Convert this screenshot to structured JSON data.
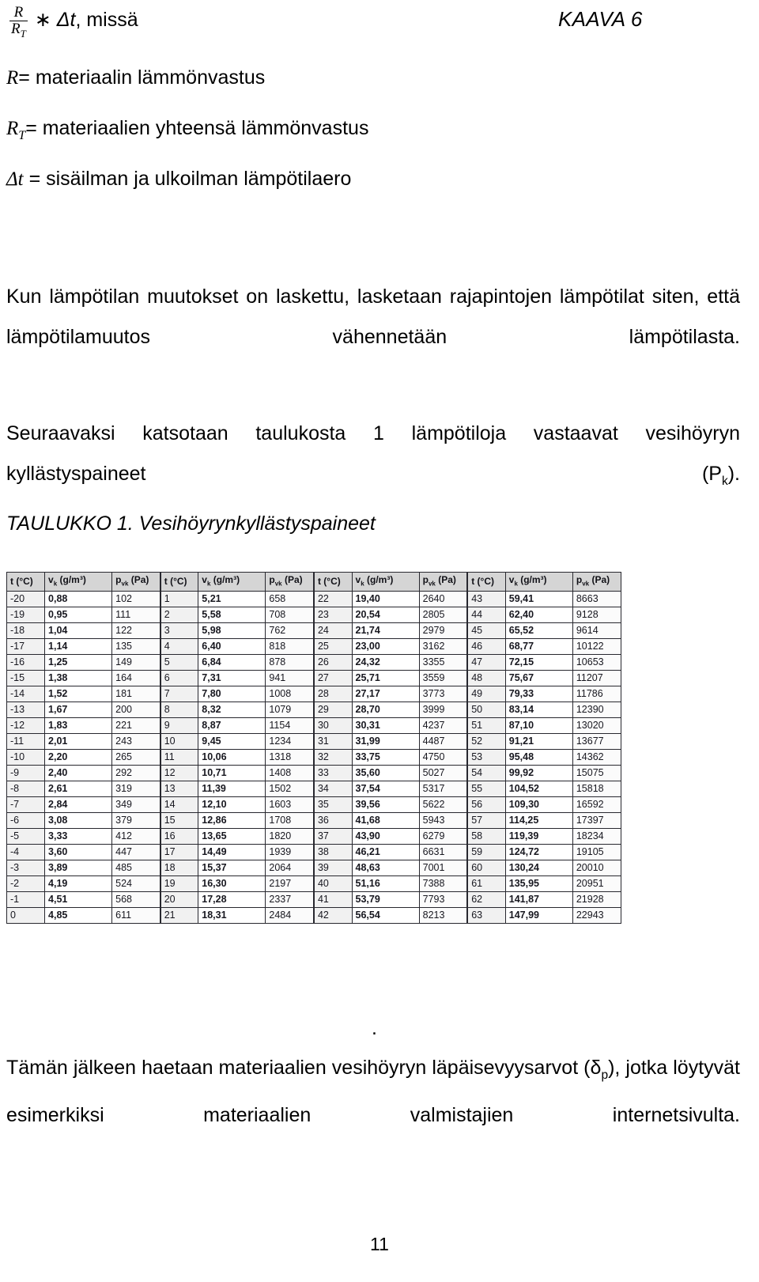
{
  "document": {
    "formula": {
      "numerator": "R",
      "denominator": "R",
      "denominator_sub": "T",
      "operator": "∗",
      "delta_t": "Δt",
      "tail": ", missä",
      "label": "KAAVA 6"
    },
    "definitions": [
      {
        "symbol": "R",
        "symbol_sub": "",
        "text": "= materiaalin lämmönvastus"
      },
      {
        "symbol": "R",
        "symbol_sub": "T",
        "text": "= materiaalien yhteensä lämmönvastus"
      },
      {
        "symbol": "Δt",
        "symbol_sub": "",
        "text": "= sisäilman ja ulkoilman lämpötilaero"
      }
    ],
    "paragraphs": {
      "kun": "Kun lämpötilan muutokset on laskettu, lasketaan rajapintojen lämpötilat siten, että lämpötilamuutos vähennetään lämpötilasta.",
      "seuraavaksi_pre": "Seuraavaksi katsotaan taulukosta 1 lämpötiloja vastaavat vesihöyryn kyllästyspaineet (P",
      "seuraavaksi_sub": "k",
      "seuraavaksi_post": ").",
      "taulukko_caption": "TAULUKKO 1. Vesihöyrynkyllästyspaineet",
      "stray_dot": ".",
      "taman_pre": "Tämän jälkeen haetaan materiaalien vesihöyryn läpäisevyysarvot (δ",
      "taman_sub": "p",
      "taman_post": "), jotka löytyvät esimerkiksi materiaalien valmistajien internetsivulta."
    },
    "page_number": "11"
  },
  "table": {
    "headers": [
      "t (°C)",
      "vk (g/m³)",
      "pvk (Pa)"
    ],
    "header_parts": [
      {
        "main": "t (",
        "unit": "°C)"
      },
      {
        "main": "v",
        "sub": "k",
        "unit": " (g/m³)"
      },
      {
        "main": "p",
        "sub": "vk",
        "unit": " (Pa)"
      }
    ],
    "groups": [
      {
        "rows": [
          [
            "-20",
            "0,88",
            "102"
          ],
          [
            "-19",
            "0,95",
            "111"
          ],
          [
            "-18",
            "1,04",
            "122"
          ],
          [
            "-17",
            "1,14",
            "135"
          ],
          [
            "-16",
            "1,25",
            "149"
          ],
          [
            "-15",
            "1,38",
            "164"
          ],
          [
            "-14",
            "1,52",
            "181"
          ],
          [
            "-13",
            "1,67",
            "200"
          ],
          [
            "-12",
            "1,83",
            "221"
          ],
          [
            "-11",
            "2,01",
            "243"
          ],
          [
            "-10",
            "2,20",
            "265"
          ],
          [
            "-9",
            "2,40",
            "292"
          ],
          [
            "-8",
            "2,61",
            "319"
          ],
          [
            "-7",
            "2,84",
            "349"
          ],
          [
            "-6",
            "3,08",
            "379"
          ],
          [
            "-5",
            "3,33",
            "412"
          ],
          [
            "-4",
            "3,60",
            "447"
          ],
          [
            "-3",
            "3,89",
            "485"
          ],
          [
            "-2",
            "4,19",
            "524"
          ],
          [
            "-1",
            "4,51",
            "568"
          ],
          [
            "0",
            "4,85",
            "611"
          ]
        ]
      },
      {
        "rows": [
          [
            "1",
            "5,21",
            "658"
          ],
          [
            "2",
            "5,58",
            "708"
          ],
          [
            "3",
            "5,98",
            "762"
          ],
          [
            "4",
            "6,40",
            "818"
          ],
          [
            "5",
            "6,84",
            "878"
          ],
          [
            "6",
            "7,31",
            "941"
          ],
          [
            "7",
            "7,80",
            "1008"
          ],
          [
            "8",
            "8,32",
            "1079"
          ],
          [
            "9",
            "8,87",
            "1154"
          ],
          [
            "10",
            "9,45",
            "1234"
          ],
          [
            "11",
            "10,06",
            "1318"
          ],
          [
            "12",
            "10,71",
            "1408"
          ],
          [
            "13",
            "11,39",
            "1502"
          ],
          [
            "14",
            "12,10",
            "1603"
          ],
          [
            "15",
            "12,86",
            "1708"
          ],
          [
            "16",
            "13,65",
            "1820"
          ],
          [
            "17",
            "14,49",
            "1939"
          ],
          [
            "18",
            "15,37",
            "2064"
          ],
          [
            "19",
            "16,30",
            "2197"
          ],
          [
            "20",
            "17,28",
            "2337"
          ],
          [
            "21",
            "18,31",
            "2484"
          ]
        ]
      },
      {
        "rows": [
          [
            "22",
            "19,40",
            "2640"
          ],
          [
            "23",
            "20,54",
            "2805"
          ],
          [
            "24",
            "21,74",
            "2979"
          ],
          [
            "25",
            "23,00",
            "3162"
          ],
          [
            "26",
            "24,32",
            "3355"
          ],
          [
            "27",
            "25,71",
            "3559"
          ],
          [
            "28",
            "27,17",
            "3773"
          ],
          [
            "29",
            "28,70",
            "3999"
          ],
          [
            "30",
            "30,31",
            "4237"
          ],
          [
            "31",
            "31,99",
            "4487"
          ],
          [
            "32",
            "33,75",
            "4750"
          ],
          [
            "33",
            "35,60",
            "5027"
          ],
          [
            "34",
            "37,54",
            "5317"
          ],
          [
            "35",
            "39,56",
            "5622"
          ],
          [
            "36",
            "41,68",
            "5943"
          ],
          [
            "37",
            "43,90",
            "6279"
          ],
          [
            "38",
            "46,21",
            "6631"
          ],
          [
            "39",
            "48,63",
            "7001"
          ],
          [
            "40",
            "51,16",
            "7388"
          ],
          [
            "41",
            "53,79",
            "7793"
          ],
          [
            "42",
            "56,54",
            "8213"
          ]
        ]
      },
      {
        "rows": [
          [
            "43",
            "59,41",
            "8663"
          ],
          [
            "44",
            "62,40",
            "9128"
          ],
          [
            "45",
            "65,52",
            "9614"
          ],
          [
            "46",
            "68,77",
            "10122"
          ],
          [
            "47",
            "72,15",
            "10653"
          ],
          [
            "48",
            "75,67",
            "11207"
          ],
          [
            "49",
            "79,33",
            "11786"
          ],
          [
            "50",
            "83,14",
            "12390"
          ],
          [
            "51",
            "87,10",
            "13020"
          ],
          [
            "52",
            "91,21",
            "13677"
          ],
          [
            "53",
            "95,48",
            "14362"
          ],
          [
            "54",
            "99,92",
            "15075"
          ],
          [
            "55",
            "104,52",
            "15818"
          ],
          [
            "56",
            "109,30",
            "16592"
          ],
          [
            "57",
            "114,25",
            "17397"
          ],
          [
            "58",
            "119,39",
            "18234"
          ],
          [
            "59",
            "124,72",
            "19105"
          ],
          [
            "60",
            "130,24",
            "20010"
          ],
          [
            "61",
            "135,95",
            "20951"
          ],
          [
            "62",
            "141,87",
            "21928"
          ],
          [
            "63",
            "147,99",
            "22943"
          ]
        ]
      }
    ]
  }
}
